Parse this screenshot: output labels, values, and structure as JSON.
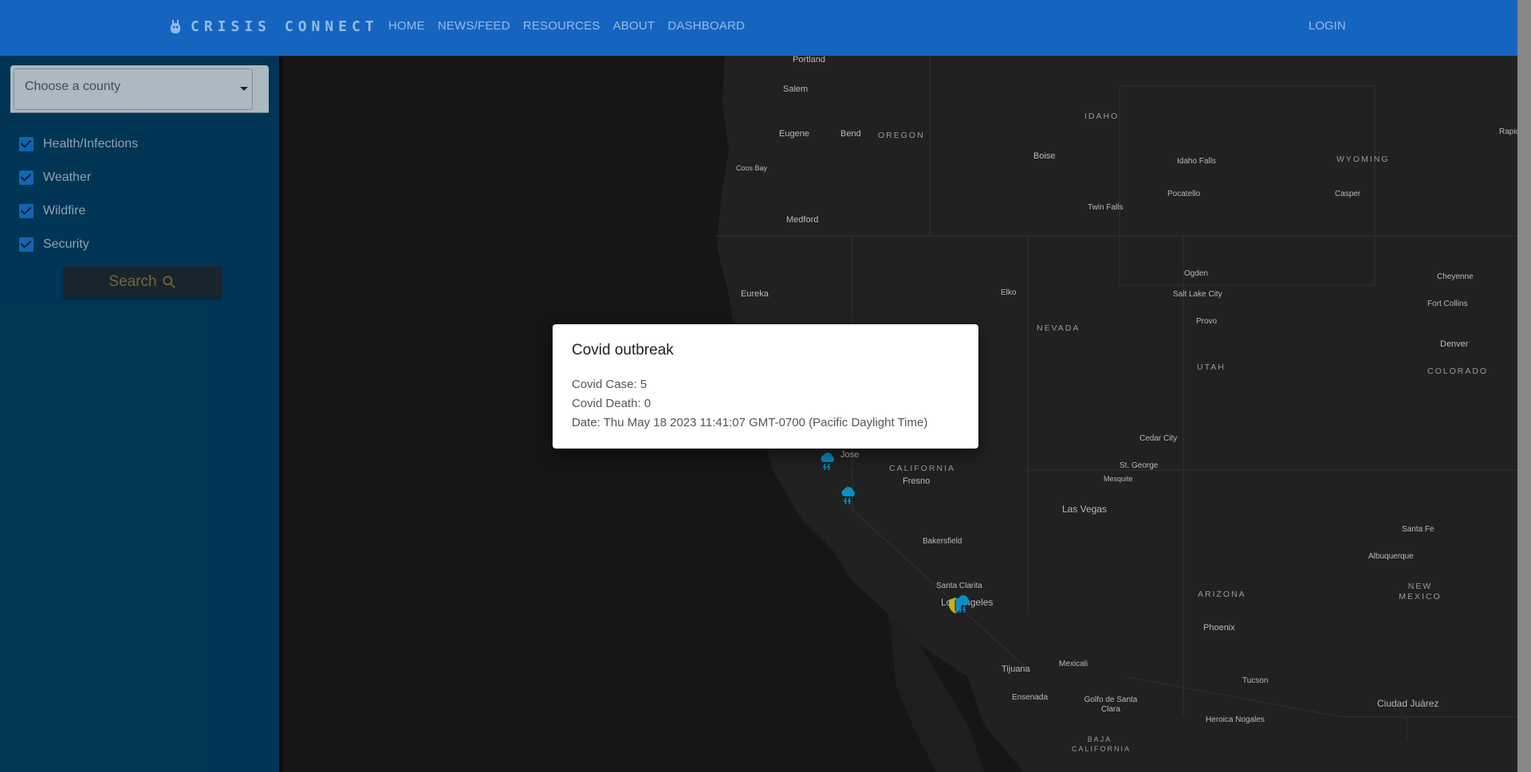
{
  "header": {
    "brand": "CRISIS CONNECT",
    "nav": [
      "HOME",
      "NEWS/FEED",
      "RESOURCES",
      "ABOUT",
      "DASHBOARD"
    ],
    "login": "LOGIN"
  },
  "sidebar": {
    "county_placeholder": "Choose a county",
    "filters": [
      {
        "label": "Health/Infections",
        "checked": true
      },
      {
        "label": "Weather",
        "checked": true
      },
      {
        "label": "Wildfire",
        "checked": true
      },
      {
        "label": "Security",
        "checked": true
      }
    ],
    "search_label": "Search"
  },
  "map": {
    "places": [
      "Portland",
      "Salem",
      "Eugene",
      "Bend",
      "OREGON",
      "Coos Bay",
      "Medford",
      "Eureka",
      "IDAHO",
      "Boise",
      "Idaho Falls",
      "Pocatello",
      "Twin Falls",
      "WYOMING",
      "Casper",
      "Rapid",
      "Cheyenne",
      "Fort Collins",
      "Denver",
      "COLORADO",
      "Elko",
      "Ogden",
      "Salt Lake City",
      "Provo",
      "NEVADA",
      "UTAH",
      "Cedar City",
      "St. George",
      "Mesquite",
      "Las Vegas",
      "Jose",
      "CALIFORNIA",
      "Fresno",
      "Bakersfield",
      "Santa Clarita",
      "Los Angeles",
      "Santa Fe",
      "Albuquerque",
      "NEW MEXICO",
      "ARIZONA",
      "Phoenix",
      "Tucson",
      "Tijuana",
      "Mexicali",
      "Ensenada",
      "Golfo de Santa Clara",
      "Heroica Nogales",
      "BAJA CALIFORNIA",
      "Ciudad Juárez"
    ],
    "marker_colors": {
      "weather": "#0a8ec2",
      "security": "#c9b21a"
    }
  },
  "popup": {
    "title": "Covid outbreak",
    "case_line": "Covid Case: 5",
    "death_line": "Covid Death: 0",
    "date_line": "Date: Thu May 18 2023 11:41:07 GMT-0700 (Pacific Daylight Time)"
  }
}
